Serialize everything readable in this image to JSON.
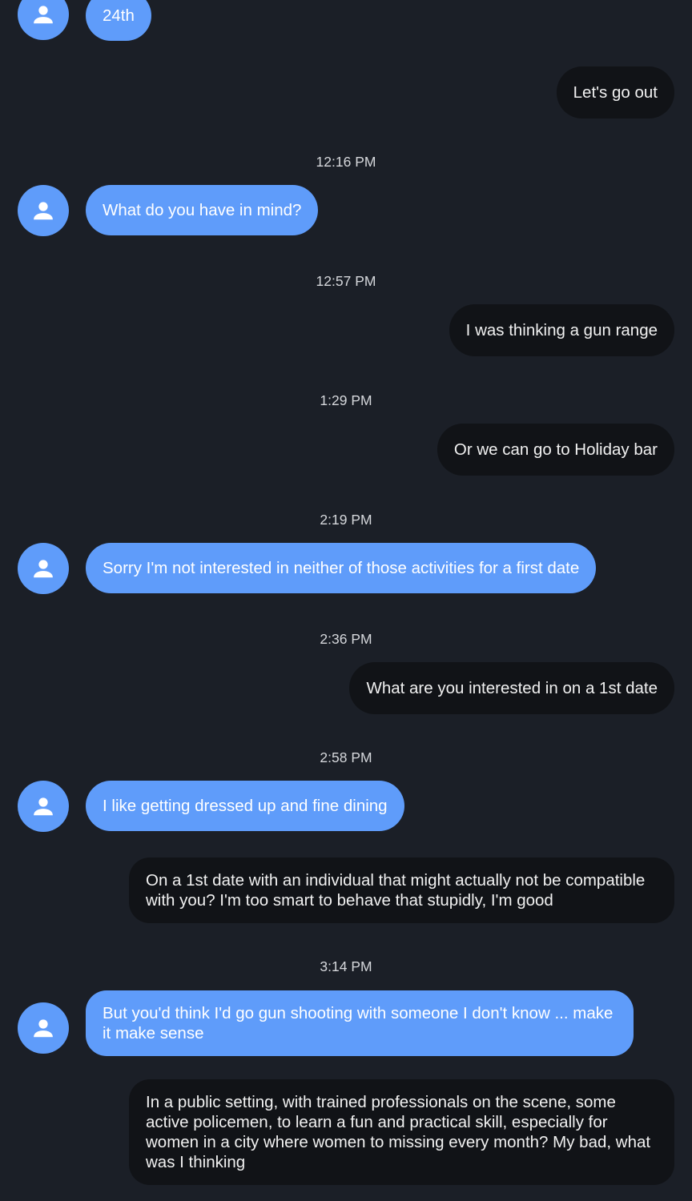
{
  "colors": {
    "background": "#1b1f27",
    "incoming_bubble": "#5f9cfa",
    "outgoing_bubble": "#111317",
    "avatar": "#5f9cfa"
  },
  "icons": {
    "avatar": "person-icon"
  },
  "messages": [
    {
      "side": "incoming",
      "text": "24th"
    },
    {
      "side": "outgoing",
      "text": "Let's go out"
    },
    {
      "type": "timestamp",
      "text": "12:16 PM"
    },
    {
      "side": "incoming",
      "text": "What do you have in mind?"
    },
    {
      "type": "timestamp",
      "text": "12:57 PM"
    },
    {
      "side": "outgoing",
      "text": "I was thinking a gun range"
    },
    {
      "type": "timestamp",
      "text": "1:29 PM"
    },
    {
      "side": "outgoing",
      "text": "Or we can go to Holiday bar"
    },
    {
      "type": "timestamp",
      "text": "2:19 PM"
    },
    {
      "side": "incoming",
      "text": "Sorry I'm not interested in neither of those activities for a first date"
    },
    {
      "type": "timestamp",
      "text": "2:36 PM"
    },
    {
      "side": "outgoing",
      "text": "What are you interested in on a 1st date"
    },
    {
      "type": "timestamp",
      "text": "2:58 PM"
    },
    {
      "side": "incoming",
      "text": "I like getting dressed up and fine dining"
    },
    {
      "side": "outgoing",
      "text": "On a 1st date with an individual that might actually not be compatible with you? I'm too smart to behave that stupidly, I'm good"
    },
    {
      "type": "timestamp",
      "text": "3:14 PM"
    },
    {
      "side": "incoming",
      "text": "But you'd think I'd go gun shooting with someone I don't know ... make it make sense"
    },
    {
      "side": "outgoing",
      "text": "In a public setting, with trained professionals on the scene, some active policemen, to learn a fun and practical skill, especially for women in a city where women to missing every month? My bad, what was I thinking"
    }
  ]
}
